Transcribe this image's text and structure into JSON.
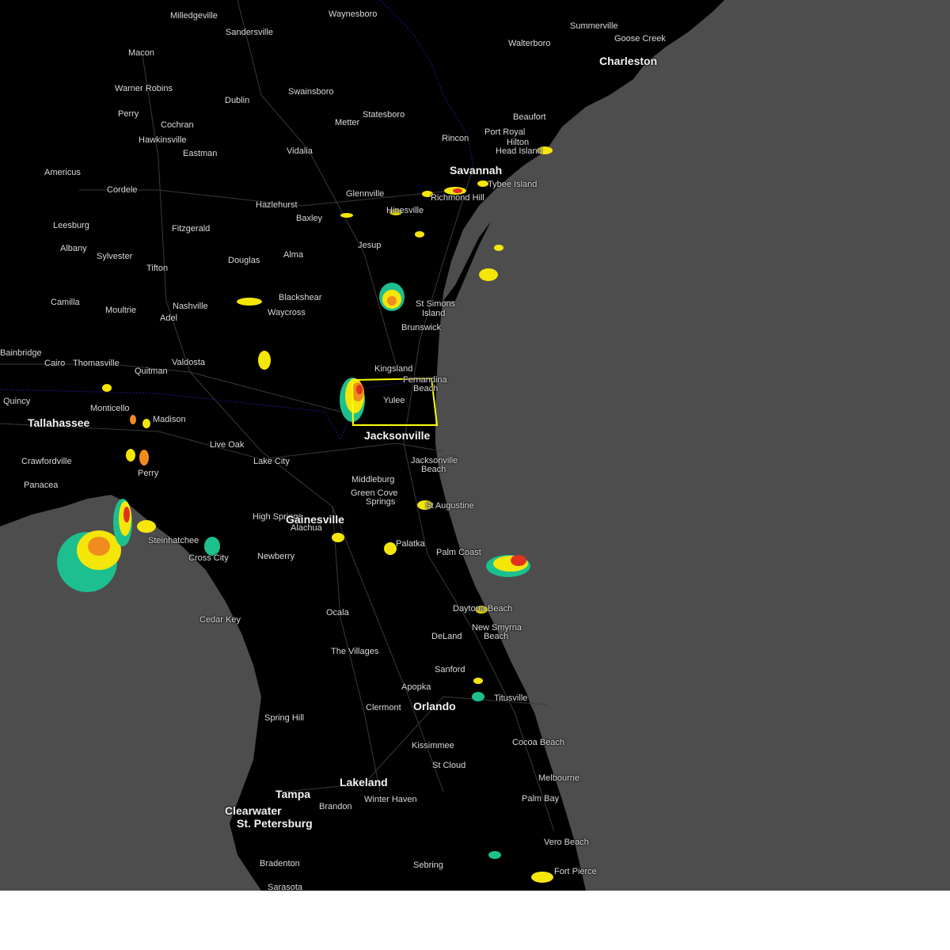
{
  "map": {
    "cities": [
      {
        "name": "Milledgeville",
        "big": false
      },
      {
        "name": "Waynesboro",
        "big": false
      },
      {
        "name": "Sandersville",
        "big": false
      },
      {
        "name": "Summerville",
        "big": false
      },
      {
        "name": "Goose Creek",
        "big": false
      },
      {
        "name": "Walterboro",
        "big": false
      },
      {
        "name": "Charleston",
        "big": true
      },
      {
        "name": "Macon",
        "big": false
      },
      {
        "name": "Warner Robins",
        "big": false
      },
      {
        "name": "Dublin",
        "big": false
      },
      {
        "name": "Swainsboro",
        "big": false
      },
      {
        "name": "Perry",
        "big": false
      },
      {
        "name": "Cochran",
        "big": false
      },
      {
        "name": "Metter",
        "big": false
      },
      {
        "name": "Statesboro",
        "big": false
      },
      {
        "name": "Beaufort",
        "big": false
      },
      {
        "name": "Port Royal",
        "big": false
      },
      {
        "name": "Hilton",
        "big": false
      },
      {
        "name": "Head Island",
        "big": false
      },
      {
        "name": "Hawkinsville",
        "big": false
      },
      {
        "name": "Rincon",
        "big": false
      },
      {
        "name": "Eastman",
        "big": false
      },
      {
        "name": "Vidalia",
        "big": false
      },
      {
        "name": "Savannah",
        "big": true
      },
      {
        "name": "Americus",
        "big": false
      },
      {
        "name": "Tybee Island",
        "big": false
      },
      {
        "name": "Cordele",
        "big": false
      },
      {
        "name": "Glennville",
        "big": false
      },
      {
        "name": "Richmond Hill",
        "big": false
      },
      {
        "name": "Hazlehurst",
        "big": false
      },
      {
        "name": "Hinesville",
        "big": false
      },
      {
        "name": "Baxley",
        "big": false
      },
      {
        "name": "Leesburg",
        "big": false
      },
      {
        "name": "Fitzgerald",
        "big": false
      },
      {
        "name": "Albany",
        "big": false
      },
      {
        "name": "Jesup",
        "big": false
      },
      {
        "name": "Sylvester",
        "big": false
      },
      {
        "name": "Alma",
        "big": false
      },
      {
        "name": "Douglas",
        "big": false
      },
      {
        "name": "Tifton",
        "big": false
      },
      {
        "name": "Blackshear",
        "big": false
      },
      {
        "name": "Camilla",
        "big": false
      },
      {
        "name": "Nashville",
        "big": false
      },
      {
        "name": "St Simons",
        "big": false
      },
      {
        "name": "Moultrie",
        "big": false
      },
      {
        "name": "Island",
        "big": false
      },
      {
        "name": "Waycross",
        "big": false
      },
      {
        "name": "Adel",
        "big": false
      },
      {
        "name": "Brunswick",
        "big": false
      },
      {
        "name": "Bainbridge",
        "big": false
      },
      {
        "name": "Cairo",
        "big": false
      },
      {
        "name": "Thomasville",
        "big": false
      },
      {
        "name": "Valdosta",
        "big": false
      },
      {
        "name": "Kingsland",
        "big": false
      },
      {
        "name": "Quitman",
        "big": false
      },
      {
        "name": "Fernandina",
        "big": false
      },
      {
        "name": "Beach",
        "big": false
      },
      {
        "name": "Quincy",
        "big": false
      },
      {
        "name": "Monticello",
        "big": false
      },
      {
        "name": "Yulee",
        "big": false
      },
      {
        "name": "Madison",
        "big": false
      },
      {
        "name": "Tallahassee",
        "big": true
      },
      {
        "name": "Jacksonville",
        "big": true
      },
      {
        "name": "Live Oak",
        "big": false
      },
      {
        "name": "Crawfordville",
        "big": false
      },
      {
        "name": "Lake City",
        "big": false
      },
      {
        "name": "Jacksonville",
        "big": false
      },
      {
        "name": "Beach",
        "big": false
      },
      {
        "name": "Perry",
        "big": false
      },
      {
        "name": "Panacea",
        "big": false
      },
      {
        "name": "Middleburg",
        "big": false
      },
      {
        "name": "Green Cove",
        "big": false
      },
      {
        "name": "Springs",
        "big": false
      },
      {
        "name": "St Augustine",
        "big": false
      },
      {
        "name": "High Springs",
        "big": false
      },
      {
        "name": "Alachua",
        "big": false
      },
      {
        "name": "Steinhatchee",
        "big": false
      },
      {
        "name": "Gainesville",
        "big": true
      },
      {
        "name": "Palatka",
        "big": false
      },
      {
        "name": "Palm Coast",
        "big": false
      },
      {
        "name": "Cross City",
        "big": false
      },
      {
        "name": "Newberry",
        "big": false
      },
      {
        "name": "Daytona Beach",
        "big": false
      },
      {
        "name": "Ocala",
        "big": false
      },
      {
        "name": "Cedar Key",
        "big": false
      },
      {
        "name": "New Smyrna",
        "big": false
      },
      {
        "name": "Beach",
        "big": false
      },
      {
        "name": "DeLand",
        "big": false
      },
      {
        "name": "The Villages",
        "big": false
      },
      {
        "name": "Sanford",
        "big": false
      },
      {
        "name": "Apopka",
        "big": false
      },
      {
        "name": "Titusville",
        "big": false
      },
      {
        "name": "Orlando",
        "big": true
      },
      {
        "name": "Clermont",
        "big": false
      },
      {
        "name": "Spring Hill",
        "big": false
      },
      {
        "name": "Cocoa Beach",
        "big": false
      },
      {
        "name": "Kissimmee",
        "big": false
      },
      {
        "name": "St Cloud",
        "big": false
      },
      {
        "name": "Melbourne",
        "big": false
      },
      {
        "name": "Lakeland",
        "big": true
      },
      {
        "name": "Tampa",
        "big": true
      },
      {
        "name": "Palm Bay",
        "big": false
      },
      {
        "name": "Winter Haven",
        "big": false
      },
      {
        "name": "Clearwater",
        "big": true
      },
      {
        "name": "Brandon",
        "big": false
      },
      {
        "name": "St. Petersburg",
        "big": true
      },
      {
        "name": "Vero Beach",
        "big": false
      },
      {
        "name": "Bradenton",
        "big": false
      },
      {
        "name": "Sebring",
        "big": false
      },
      {
        "name": "Fort Pierce",
        "big": false
      },
      {
        "name": "Sarasota",
        "big": false
      }
    ],
    "colors": {
      "ocean": "#4d4d4d",
      "land": "#000000",
      "warning_box": "#ffff00",
      "radar_light": "#1dbf8f",
      "radar_yellow": "#f5e60a",
      "radar_orange": "#f08c1e",
      "radar_red": "#e0321e",
      "state_border": "#1a1a8c"
    }
  }
}
